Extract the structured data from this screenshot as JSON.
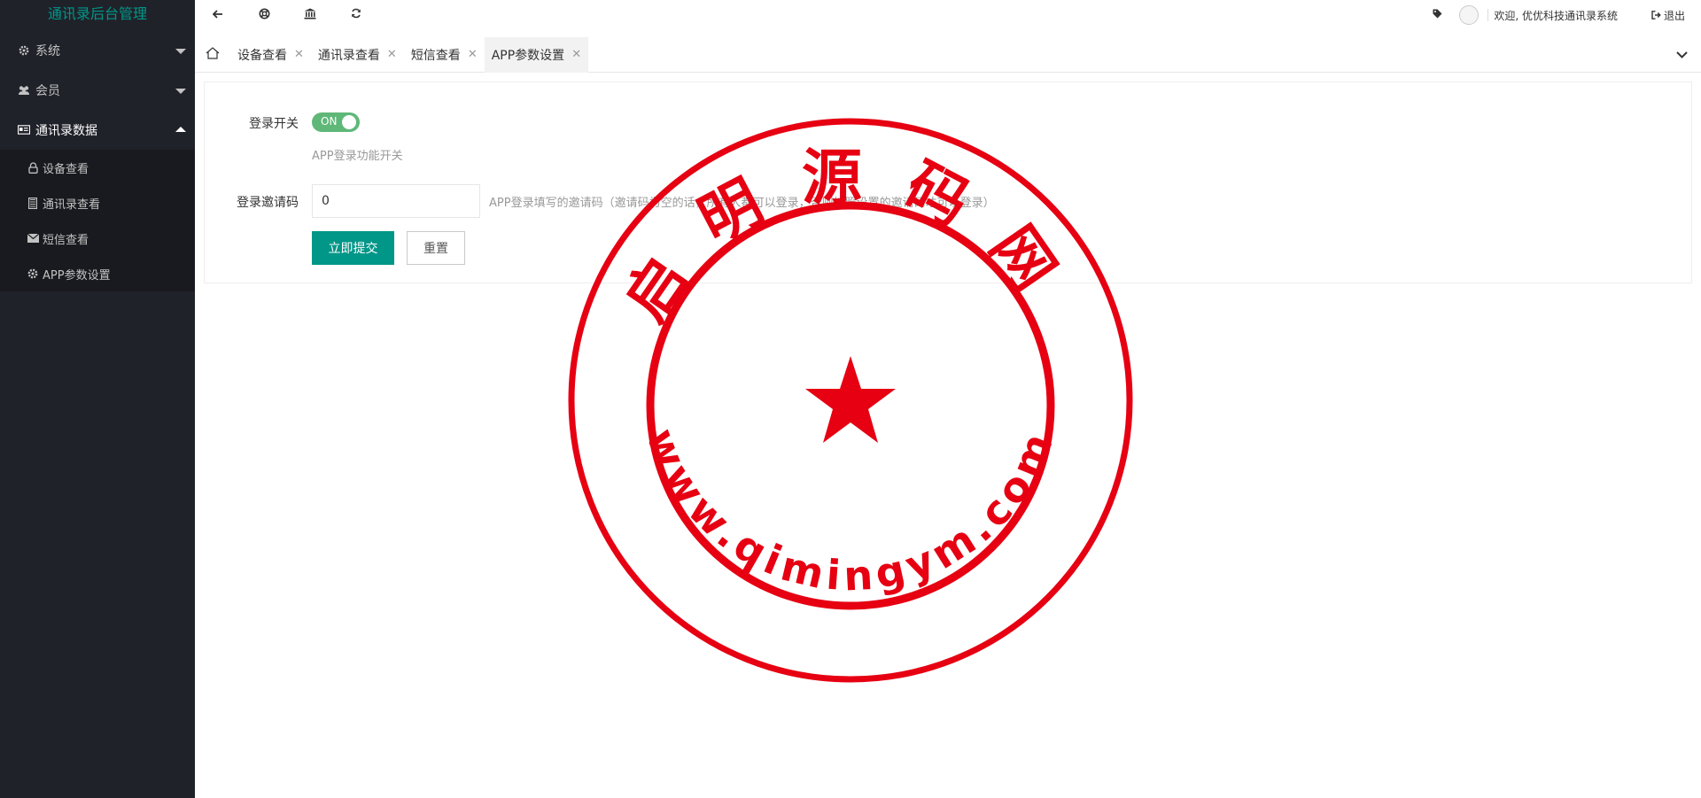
{
  "sidebar": {
    "logo": "通讯录后台管理",
    "menus": [
      {
        "label": "系统",
        "icon": "gear-icon"
      },
      {
        "label": "会员",
        "icon": "users-icon"
      },
      {
        "label": "通讯录数据",
        "icon": "id-card-icon"
      }
    ],
    "sub_items": [
      {
        "label": "设备查看",
        "icon": "lock-icon"
      },
      {
        "label": "通讯录查看",
        "icon": "book-icon"
      },
      {
        "label": "短信查看",
        "icon": "envelope-icon"
      },
      {
        "label": "APP参数设置",
        "icon": "gear-icon"
      }
    ]
  },
  "header": {
    "toolbar_icons": [
      "arrow-left-icon",
      "life-ring-icon",
      "bank-icon",
      "refresh-icon"
    ],
    "welcome": "欢迎, 优优科技通讯录系统",
    "logout": "退出"
  },
  "tabs": [
    {
      "label": "设备查看",
      "active": false
    },
    {
      "label": "通讯录查看",
      "active": false
    },
    {
      "label": "短信查看",
      "active": false
    },
    {
      "label": "APP参数设置",
      "active": true
    }
  ],
  "form": {
    "login_switch": {
      "label": "登录开关",
      "state": "ON",
      "help": "APP登录功能开关"
    },
    "invite_code": {
      "label": "登录邀请码",
      "value": "0",
      "help": "APP登录填写的邀请码（邀请码为空的话，所有人都可以登录，否则按照设置的邀请码才可以登录）"
    },
    "submit": "立即提交",
    "reset": "重置"
  },
  "watermark": {
    "top_text": "启明源码网",
    "bottom_text": "www.qimingym.com",
    "color": "#e60012"
  },
  "colors": {
    "sidebar_bg": "#20222a",
    "accent": "#009688",
    "switch_on": "#5fb878"
  }
}
